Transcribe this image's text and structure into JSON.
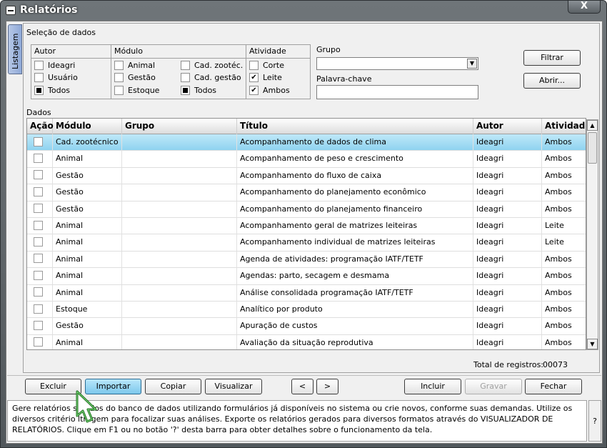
{
  "window": {
    "title": "Relatórios",
    "close_label": "X"
  },
  "side_tab": {
    "label": "Listagem"
  },
  "selection": {
    "title": "Seleção de dados",
    "autor": {
      "title": "Autor",
      "options": [
        {
          "label": "Ideagri",
          "state": "unchecked"
        },
        {
          "label": "Usuário",
          "state": "unchecked"
        },
        {
          "label": "Todos",
          "state": "filled"
        }
      ]
    },
    "modulo": {
      "title": "Módulo",
      "col1": [
        {
          "label": "Animal",
          "state": "unchecked"
        },
        {
          "label": "Gestão",
          "state": "unchecked"
        },
        {
          "label": "Estoque",
          "state": "unchecked"
        }
      ],
      "col2": [
        {
          "label": "Cad. zootéc.",
          "state": "unchecked"
        },
        {
          "label": "Cad. gestão",
          "state": "unchecked"
        },
        {
          "label": "Todos",
          "state": "filled"
        }
      ]
    },
    "atividade": {
      "title": "Atividade",
      "options": [
        {
          "label": "Corte",
          "state": "unchecked"
        },
        {
          "label": "Leite",
          "state": "checked"
        },
        {
          "label": "Ambos",
          "state": "checked"
        }
      ]
    },
    "grupo": {
      "label": "Grupo",
      "value": ""
    },
    "palavra": {
      "label": "Palavra-chave",
      "value": ""
    },
    "filtrar_label": "Filtrar",
    "abrir_label": "Abrir..."
  },
  "dados": {
    "title": "Dados",
    "columns": [
      "Ação",
      "Módulo",
      "Grupo",
      "Título",
      "Autor",
      "Atividade"
    ],
    "rows": [
      {
        "modulo": "Cad. zootécnico",
        "grupo": "",
        "titulo": "Acompanhamento de dados de clima",
        "autor": "Ideagri",
        "atividade": "Ambos",
        "selected": true
      },
      {
        "modulo": "Animal",
        "grupo": "",
        "titulo": "Acompanhamento de peso e crescimento",
        "autor": "Ideagri",
        "atividade": "Ambos"
      },
      {
        "modulo": "Gestão",
        "grupo": "",
        "titulo": "Acompanhamento do fluxo de caixa",
        "autor": "Ideagri",
        "atividade": "Ambos"
      },
      {
        "modulo": "Gestão",
        "grupo": "",
        "titulo": "Acompanhamento do planejamento econômico",
        "autor": "Ideagri",
        "atividade": "Ambos"
      },
      {
        "modulo": "Gestão",
        "grupo": "",
        "titulo": "Acompanhamento do planejamento financeiro",
        "autor": "Ideagri",
        "atividade": "Ambos"
      },
      {
        "modulo": "Animal",
        "grupo": "",
        "titulo": "Acompanhamento geral de matrizes leiteiras",
        "autor": "Ideagri",
        "atividade": "Leite"
      },
      {
        "modulo": "Animal",
        "grupo": "",
        "titulo": "Acompanhamento individual de matrizes leiteiras",
        "autor": "Ideagri",
        "atividade": "Leite"
      },
      {
        "modulo": "Animal",
        "grupo": "",
        "titulo": "Agenda de atividades: programação IATF/TETF",
        "autor": "Ideagri",
        "atividade": "Ambos"
      },
      {
        "modulo": "Animal",
        "grupo": "",
        "titulo": "Agendas: parto, secagem e desmama",
        "autor": "Ideagri",
        "atividade": "Ambos"
      },
      {
        "modulo": "Animal",
        "grupo": "",
        "titulo": "Análise consolidada programação IATF/TETF",
        "autor": "Ideagri",
        "atividade": "Ambos"
      },
      {
        "modulo": "Estoque",
        "grupo": "",
        "titulo": "Analítico por produto",
        "autor": "Ideagri",
        "atividade": "Ambos"
      },
      {
        "modulo": "Gestão",
        "grupo": "",
        "titulo": "Apuração de custos",
        "autor": "Ideagri",
        "atividade": "Ambos"
      },
      {
        "modulo": "Animal",
        "grupo": "",
        "titulo": "Avaliação da situação reprodutiva",
        "autor": "Ideagri",
        "atividade": "Ambos"
      }
    ],
    "total_label": "Total de registros:",
    "total_value": "00073"
  },
  "buttons": {
    "excluir": "Excluir",
    "importar": "Importar",
    "copiar": "Copiar",
    "visualizar": "Visualizar",
    "prev": "<",
    "next": ">",
    "incluir": "Incluir",
    "gravar": "Gravar",
    "fechar": "Fechar"
  },
  "help": {
    "text": "Gere relatórios s         dados do banco de dados utilizando formulários já disponíveis no sistema ou crie novos, conforme suas demandas. Utilize os diversos critério     ltragem para focalizar suas análises. Exporte os relatórios gerados para diversos formatos através do VISUALIZADOR DE RELATÓRIOS. Clique em F1 ou no botão '?' desta barra para obter detalhes sobre o funcionamento da tela.",
    "question_label": "?"
  },
  "colors": {
    "selected_row": "#8fd3f0",
    "hot_button": "#7cc8ec",
    "title_bar": "#5d6367"
  }
}
